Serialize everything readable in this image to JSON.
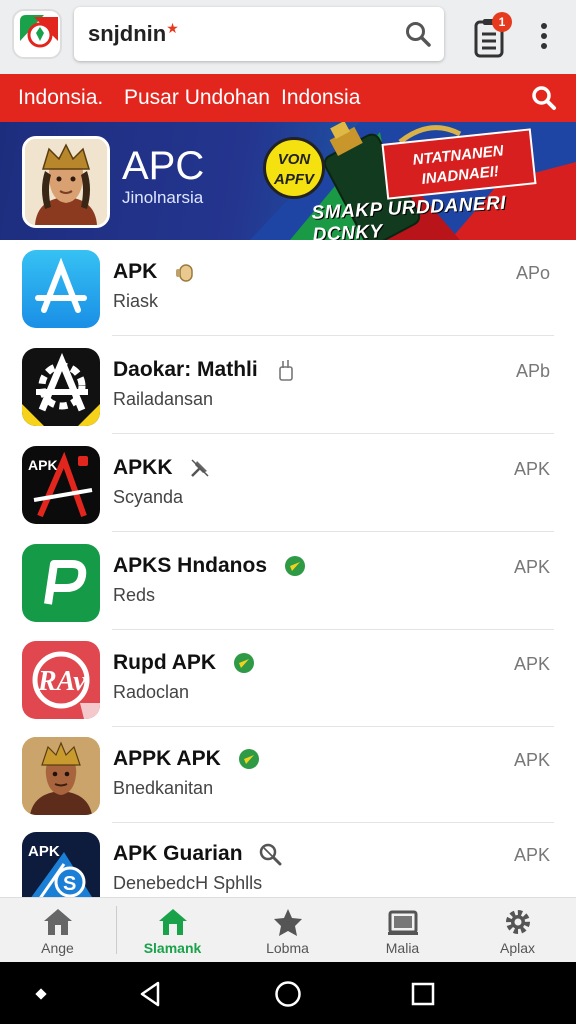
{
  "header": {
    "search_text": "snjdnin",
    "search_mark": "★",
    "notification_count": "1"
  },
  "breadcrumb": {
    "item1": "Indonsia.",
    "item2": "Pusar Undohan",
    "item3": "Indonsia"
  },
  "banner": {
    "title": "APC",
    "subtitle": "Jinolnarsia",
    "badge_text": "VON APFV",
    "promo_label": "NTATNANEN INADNAEI!",
    "tagline": "SMAKP URDDANERI DCNKY"
  },
  "apps": [
    {
      "title": "APK",
      "subtitle": "Riask",
      "tag": "APo",
      "icon": "app-store-icon",
      "badge_icon": "thumb-icon"
    },
    {
      "title": "Daokar: Mathli",
      "subtitle": "Railadansan",
      "tag": "APb",
      "icon": "gear-logo-icon",
      "badge_icon": "hand-icon"
    },
    {
      "title": "APKK",
      "subtitle": "Scyanda",
      "tag": "APK",
      "icon": "apk-a-logo-icon",
      "badge_icon": "pin-icon"
    },
    {
      "title": "APKS Hndanos",
      "subtitle": "Reds",
      "tag": "APK",
      "icon": "p-logo-icon",
      "badge_icon": "verified-icon"
    },
    {
      "title": "Rupd APK",
      "subtitle": "Radoclan",
      "tag": "APK",
      "icon": "rav-logo-icon",
      "badge_icon": "verified-icon"
    },
    {
      "title": "APPK APK",
      "subtitle": "Bnedkanitan",
      "tag": "APK",
      "icon": "portrait-icon",
      "badge_icon": "verified-icon"
    },
    {
      "title": "APK Guarian",
      "subtitle": "DenebedcH Sphlls",
      "tag": "APK",
      "icon": "apk-s-logo-icon",
      "badge_icon": "magnifier-icon"
    }
  ],
  "bottom_nav": [
    {
      "label": "Ange",
      "icon": "home-icon"
    },
    {
      "label": "Slamank",
      "icon": "store-icon",
      "active": true
    },
    {
      "label": "Lobma",
      "icon": "star-icon"
    },
    {
      "label": "Malia",
      "icon": "media-icon"
    },
    {
      "label": "Aplax",
      "icon": "settings-icon"
    }
  ],
  "colors": {
    "accent_red": "#e3261d",
    "active_green": "#1aa24a",
    "banner_blue": "#24358f"
  }
}
